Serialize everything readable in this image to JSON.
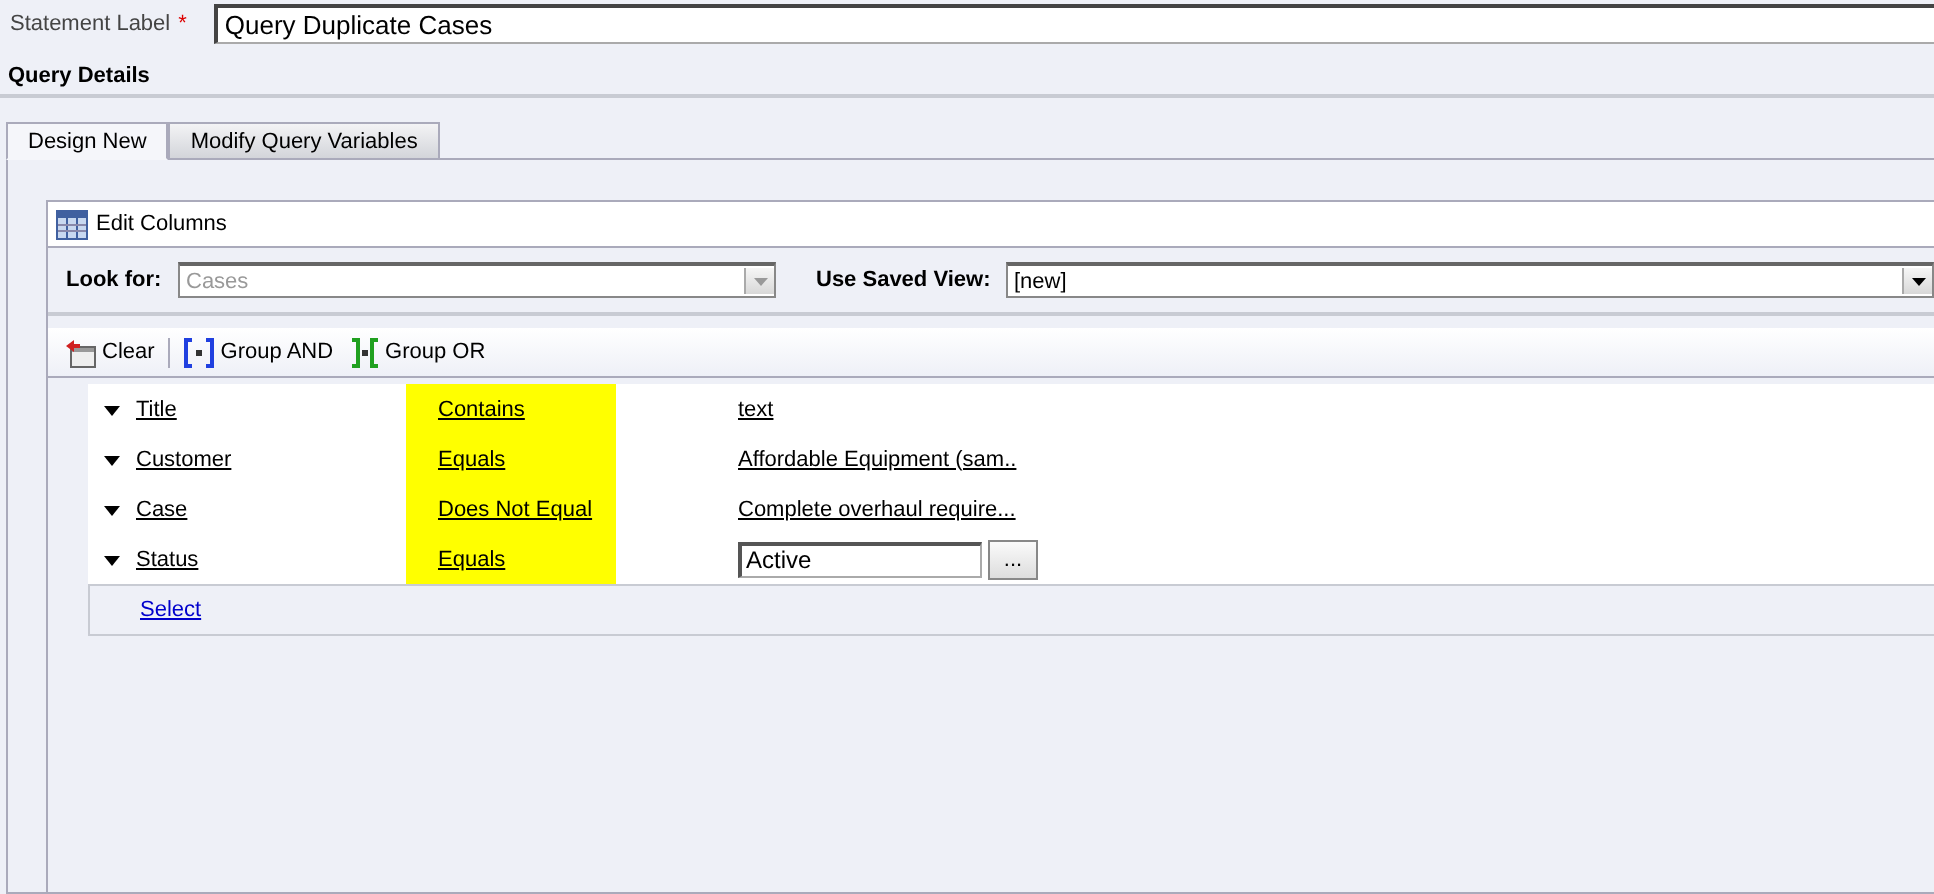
{
  "statement": {
    "label": "Statement Label",
    "required_mark": "*",
    "value": "Query Duplicate Cases"
  },
  "section_title": "Query Details",
  "tabs": [
    {
      "label": "Design New",
      "selected": true
    },
    {
      "label": "Modify Query Variables",
      "selected": false
    }
  ],
  "edit_columns": "Edit Columns",
  "look_for": {
    "label": "Look for:",
    "value": "Cases",
    "disabled": true
  },
  "saved_view": {
    "label": "Use Saved View:",
    "value": "[new]",
    "disabled": false
  },
  "toolbar": [
    {
      "kind": "clear",
      "label": "Clear"
    },
    {
      "kind": "and",
      "label": "Group AND"
    },
    {
      "kind": "or",
      "label": "Group OR"
    }
  ],
  "criteria": [
    {
      "field": "Title",
      "operator": "Contains",
      "highlighted": true,
      "kind": "link",
      "value": "text"
    },
    {
      "field": "Customer",
      "operator": "Equals",
      "highlighted": true,
      "kind": "link",
      "value": "Affordable Equipment (sam.."
    },
    {
      "field": "Case",
      "operator": "Does Not Equal",
      "highlighted": true,
      "kind": "link",
      "value": "Complete overhaul require..."
    },
    {
      "field": "Status",
      "operator": "Equals",
      "highlighted": true,
      "kind": "input",
      "value": "Active",
      "button": "..."
    }
  ],
  "select_link": "Select"
}
